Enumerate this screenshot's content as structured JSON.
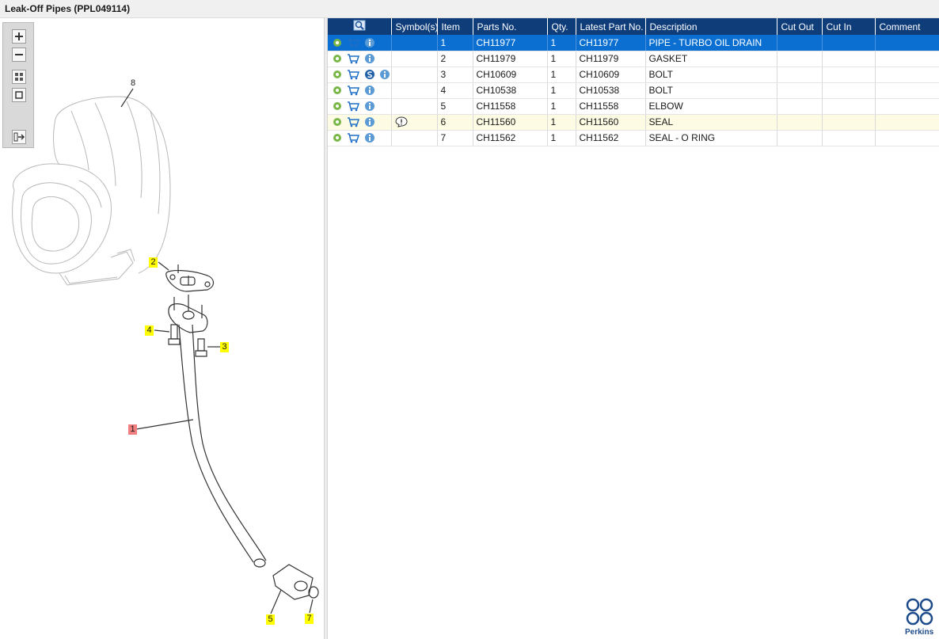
{
  "window": {
    "title": "Leak-Off Pipes (PPL049114)"
  },
  "toolbar": {
    "zoom_in": "zoom-in",
    "zoom_out": "zoom-out",
    "fit": "fit-to-window",
    "actual_size": "actual-size",
    "export": "export"
  },
  "diagram": {
    "callouts": [
      {
        "label": "8",
        "highlight": "none"
      },
      {
        "label": "2",
        "highlight": "yellow"
      },
      {
        "label": "4",
        "highlight": "yellow"
      },
      {
        "label": "3",
        "highlight": "yellow"
      },
      {
        "label": "1",
        "highlight": "red"
      },
      {
        "label": "5",
        "highlight": "yellow"
      },
      {
        "label": "7",
        "highlight": "yellow"
      }
    ]
  },
  "table": {
    "headers": {
      "symbols": "Symbol(s)",
      "item": "Item",
      "parts_no": "Parts No.",
      "qty": "Qty.",
      "latest_part_no": "Latest Part No.",
      "description": "Description",
      "cut_out": "Cut Out",
      "cut_in": "Cut In",
      "comment": "Comment"
    },
    "rows": [
      {
        "item": "1",
        "parts_no": "CH11977",
        "qty": "1",
        "latest": "CH11977",
        "description": "PIPE - TURBO OIL DRAIN",
        "cut_out": "",
        "cut_in": "",
        "comment": ""
      },
      {
        "item": "2",
        "parts_no": "CH11979",
        "qty": "1",
        "latest": "CH11979",
        "description": "GASKET",
        "cut_out": "",
        "cut_in": "",
        "comment": ""
      },
      {
        "item": "3",
        "parts_no": "CH10609",
        "qty": "1",
        "latest": "CH10609",
        "description": "BOLT",
        "cut_out": "",
        "cut_in": "",
        "comment": ""
      },
      {
        "item": "4",
        "parts_no": "CH10538",
        "qty": "1",
        "latest": "CH10538",
        "description": "BOLT",
        "cut_out": "",
        "cut_in": "",
        "comment": ""
      },
      {
        "item": "5",
        "parts_no": "CH11558",
        "qty": "1",
        "latest": "CH11558",
        "description": "ELBOW",
        "cut_out": "",
        "cut_in": "",
        "comment": ""
      },
      {
        "item": "6",
        "parts_no": "CH11560",
        "qty": "1",
        "latest": "CH11560",
        "description": "SEAL",
        "cut_out": "",
        "cut_in": "",
        "comment": ""
      },
      {
        "item": "7",
        "parts_no": "CH11562",
        "qty": "1",
        "latest": "CH11562",
        "description": "SEAL - O RING",
        "cut_out": "",
        "cut_in": "",
        "comment": ""
      }
    ]
  },
  "brand": {
    "name": "Perkins",
    "color": "#1c4a8a"
  },
  "colors": {
    "header_bg": "#0f3d7a",
    "selected_row": "#0a6fd1",
    "highlight_row": "#fdfbe3",
    "callout_yellow": "#ffff00",
    "callout_red": "#f08080"
  }
}
